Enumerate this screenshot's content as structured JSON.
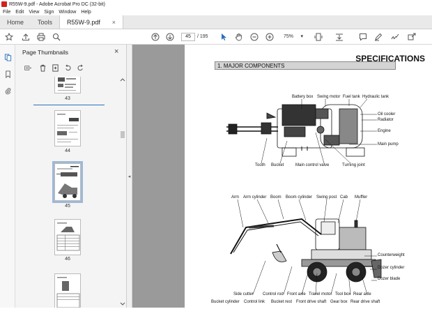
{
  "window": {
    "title": "R55W-9.pdf - Adobe Acrobat Pro DC (32-bit)"
  },
  "menu": [
    "File",
    "Edit",
    "View",
    "Sign",
    "Window",
    "Help"
  ],
  "tabs": {
    "home": "Home",
    "tools": "Tools",
    "doc": "R55W-9.pdf",
    "doc_close": "×"
  },
  "toolbar": {
    "page_current": "45",
    "page_total": "/ 195",
    "zoom": "75%",
    "zoom_caret": "▾"
  },
  "panel": {
    "title": "Page Thumbnails",
    "close": "×",
    "thumbnails": [
      {
        "label": "43",
        "selected": false
      },
      {
        "label": "44",
        "selected": false
      },
      {
        "label": "45",
        "selected": true
      },
      {
        "label": "46",
        "selected": false
      }
    ]
  },
  "document": {
    "heading": "SPECIFICATIONS",
    "section": "1. MAJOR COMPONENTS",
    "top_labels": {
      "battery_box": "Battery box",
      "swing_motor": "Swing motor",
      "fuel_tank": "Fuel tank",
      "hydraulic_tank": "Hydraulic tank",
      "oil_cooler": "Oil cooler",
      "radiator": "Radiator",
      "engine": "Engine",
      "main_pump": "Main pump",
      "tooth": "Tooth",
      "bucket": "Bucket",
      "main_control_valve": "Main control valve",
      "turning_joint": "Turning joint"
    },
    "side_labels": {
      "arm": "Arm",
      "arm_cylinder": "Arm cylinder",
      "boom": "Boom",
      "boom_cylinder": "Boom cylinder",
      "swing_post": "Swing post",
      "cab": "Cab",
      "muffler": "Muffler",
      "counterweight": "Counterweight",
      "dozer_cylinder": "Dozer cylinder",
      "dozer_blade": "Dozer blade",
      "side_cutter": "Side cutter",
      "control_rod": "Control rod",
      "front_axle": "Front axle",
      "travel_motor": "Travel motor",
      "tool_box": "Tool box",
      "rear_axle": "Rear axle",
      "bucket_cylinder": "Bucket cylinder",
      "control_link": "Control link",
      "bucket_rest": "Bucket rest",
      "front_drive_shaft": "Front drive shaft",
      "gear_box": "Gear box",
      "rear_drive_shaft": "Rear drive shaft"
    }
  },
  "colors": {
    "accent": "#d41f1f",
    "tab_bg": "#e9e9e9",
    "viewer_bg": "#9a9a9a",
    "selection": "#9fb8d6"
  }
}
